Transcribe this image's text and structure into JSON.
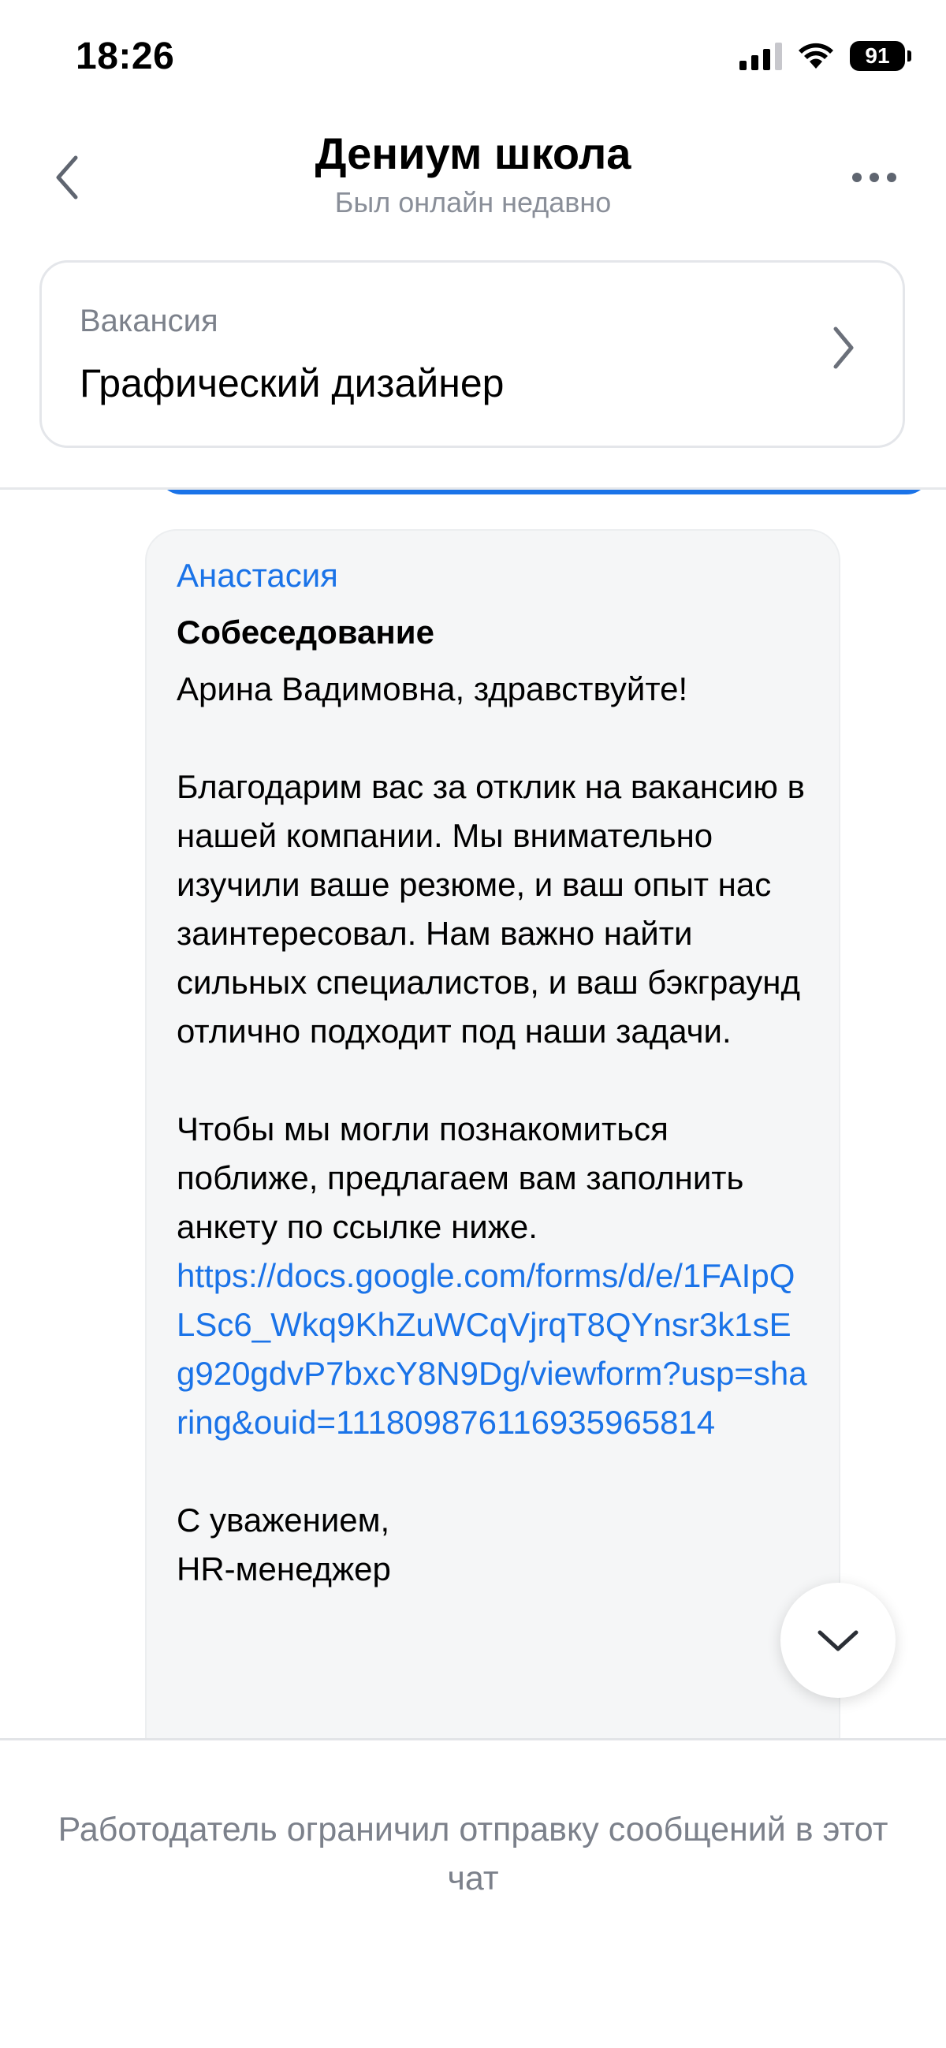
{
  "status_bar": {
    "time": "18:26",
    "battery": "91"
  },
  "header": {
    "title": "Дениум школа",
    "subtitle": "Был онлайн недавно"
  },
  "vacancy": {
    "label": "Вакансия",
    "title": "Графический дизайнер"
  },
  "message": {
    "sender": "Анастасия",
    "subject": "Собеседование",
    "greeting": "Арина Вадимовна, здравствуйте!",
    "paragraph1": "Благодарим вас за отклик на вакансию в нашей компании. Мы внимательно изучили ваше резюме, и ваш опыт нас заинтересовал. Нам важно найти сильных специалистов, и ваш бэкграунд отлично подходит под наши задачи.",
    "paragraph2": "Чтобы мы могли познакомиться поближе, предлагаем вам заполнить анкету по ссылке ниже.",
    "link": "https://docs.google.com/forms/d/e/1FAIpQLSc6_Wkq9KhZuWCqVjrqT8QYnsr3k1sEg920gdvP7bxcY8N9Dg/viewform?usp=sharing&ouid=111809876116935965814",
    "signoff": "С уважением,\nHR-менеджер"
  },
  "footer": {
    "notice": "Работодатель ограничил отправку сообщений в этот чат"
  },
  "colors": {
    "accent": "#1a73e8",
    "secondary_text": "#7c818b",
    "bubble_background": "#f5f6f7"
  },
  "icons": {
    "back": "chevron-left-icon",
    "more": "more-horizontal-icon",
    "vacancy_open": "chevron-right-icon",
    "scroll_down": "chevron-down-icon"
  }
}
